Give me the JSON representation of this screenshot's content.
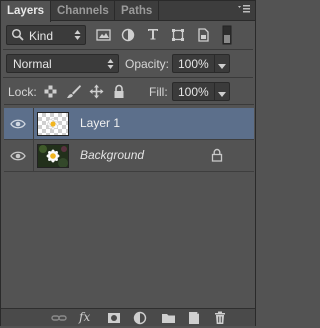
{
  "tabs": [
    {
      "label": "Layers",
      "active": true
    },
    {
      "label": "Channels",
      "active": false
    },
    {
      "label": "Paths",
      "active": false
    }
  ],
  "filter": {
    "label": "Kind",
    "icon": "search-icon"
  },
  "filter_icons": [
    "image-filter-icon",
    "adjustment-filter-icon",
    "type-filter-icon",
    "shape-filter-icon",
    "smart-object-filter-icon",
    "filter-toggle-icon"
  ],
  "blend": {
    "mode": "Normal",
    "opacity_label": "Opacity:",
    "opacity_value": "100%"
  },
  "lock": {
    "label": "Lock:",
    "fill_label": "Fill:",
    "fill_value": "100%",
    "icons": [
      "lock-transparent-icon",
      "lock-image-icon",
      "lock-position-icon",
      "lock-all-icon"
    ]
  },
  "layers": [
    {
      "name": "Layer 1",
      "selected": true,
      "visible": true,
      "locked": false,
      "italic": false
    },
    {
      "name": "Background",
      "selected": false,
      "visible": true,
      "locked": true,
      "italic": true
    }
  ],
  "footer": {
    "fx_label": "fx",
    "icons": [
      "link-layers-icon",
      "fx-icon",
      "add-mask-icon",
      "adjustment-layer-icon",
      "new-group-icon",
      "new-layer-icon",
      "delete-layer-icon"
    ]
  },
  "colors": {
    "panel": "#535353",
    "selected": "#5c6f8b",
    "tabbar": "#3d3d3d"
  }
}
